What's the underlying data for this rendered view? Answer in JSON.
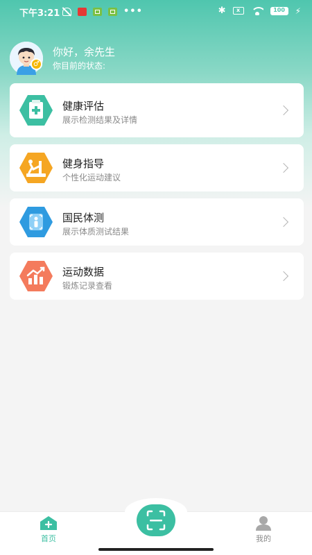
{
  "status_bar": {
    "time": "下午3:21",
    "dots": "•••",
    "battery": "100",
    "sim_text": "x"
  },
  "profile": {
    "greeting": "你好，余先生",
    "status_label": "你目前的状态:",
    "gender_symbol": "♂"
  },
  "cards": [
    {
      "title": "健康评估",
      "subtitle": "展示检测结果及详情",
      "icon": "health-assessment-icon",
      "color": "#3cbfa2"
    },
    {
      "title": "健身指导",
      "subtitle": "个性化运动建议",
      "icon": "fitness-guidance-icon",
      "color": "#f5a623"
    },
    {
      "title": "国民体测",
      "subtitle": "展示体质测试结果",
      "icon": "national-fitness-test-icon",
      "color": "#2f9be0"
    },
    {
      "title": "运动数据",
      "subtitle": "锻炼记录查看",
      "icon": "exercise-data-icon",
      "color": "#f47b5d"
    }
  ],
  "bottom_nav": {
    "home_label": "首页",
    "mine_label": "我的",
    "active_color": "#3cbfa2"
  }
}
